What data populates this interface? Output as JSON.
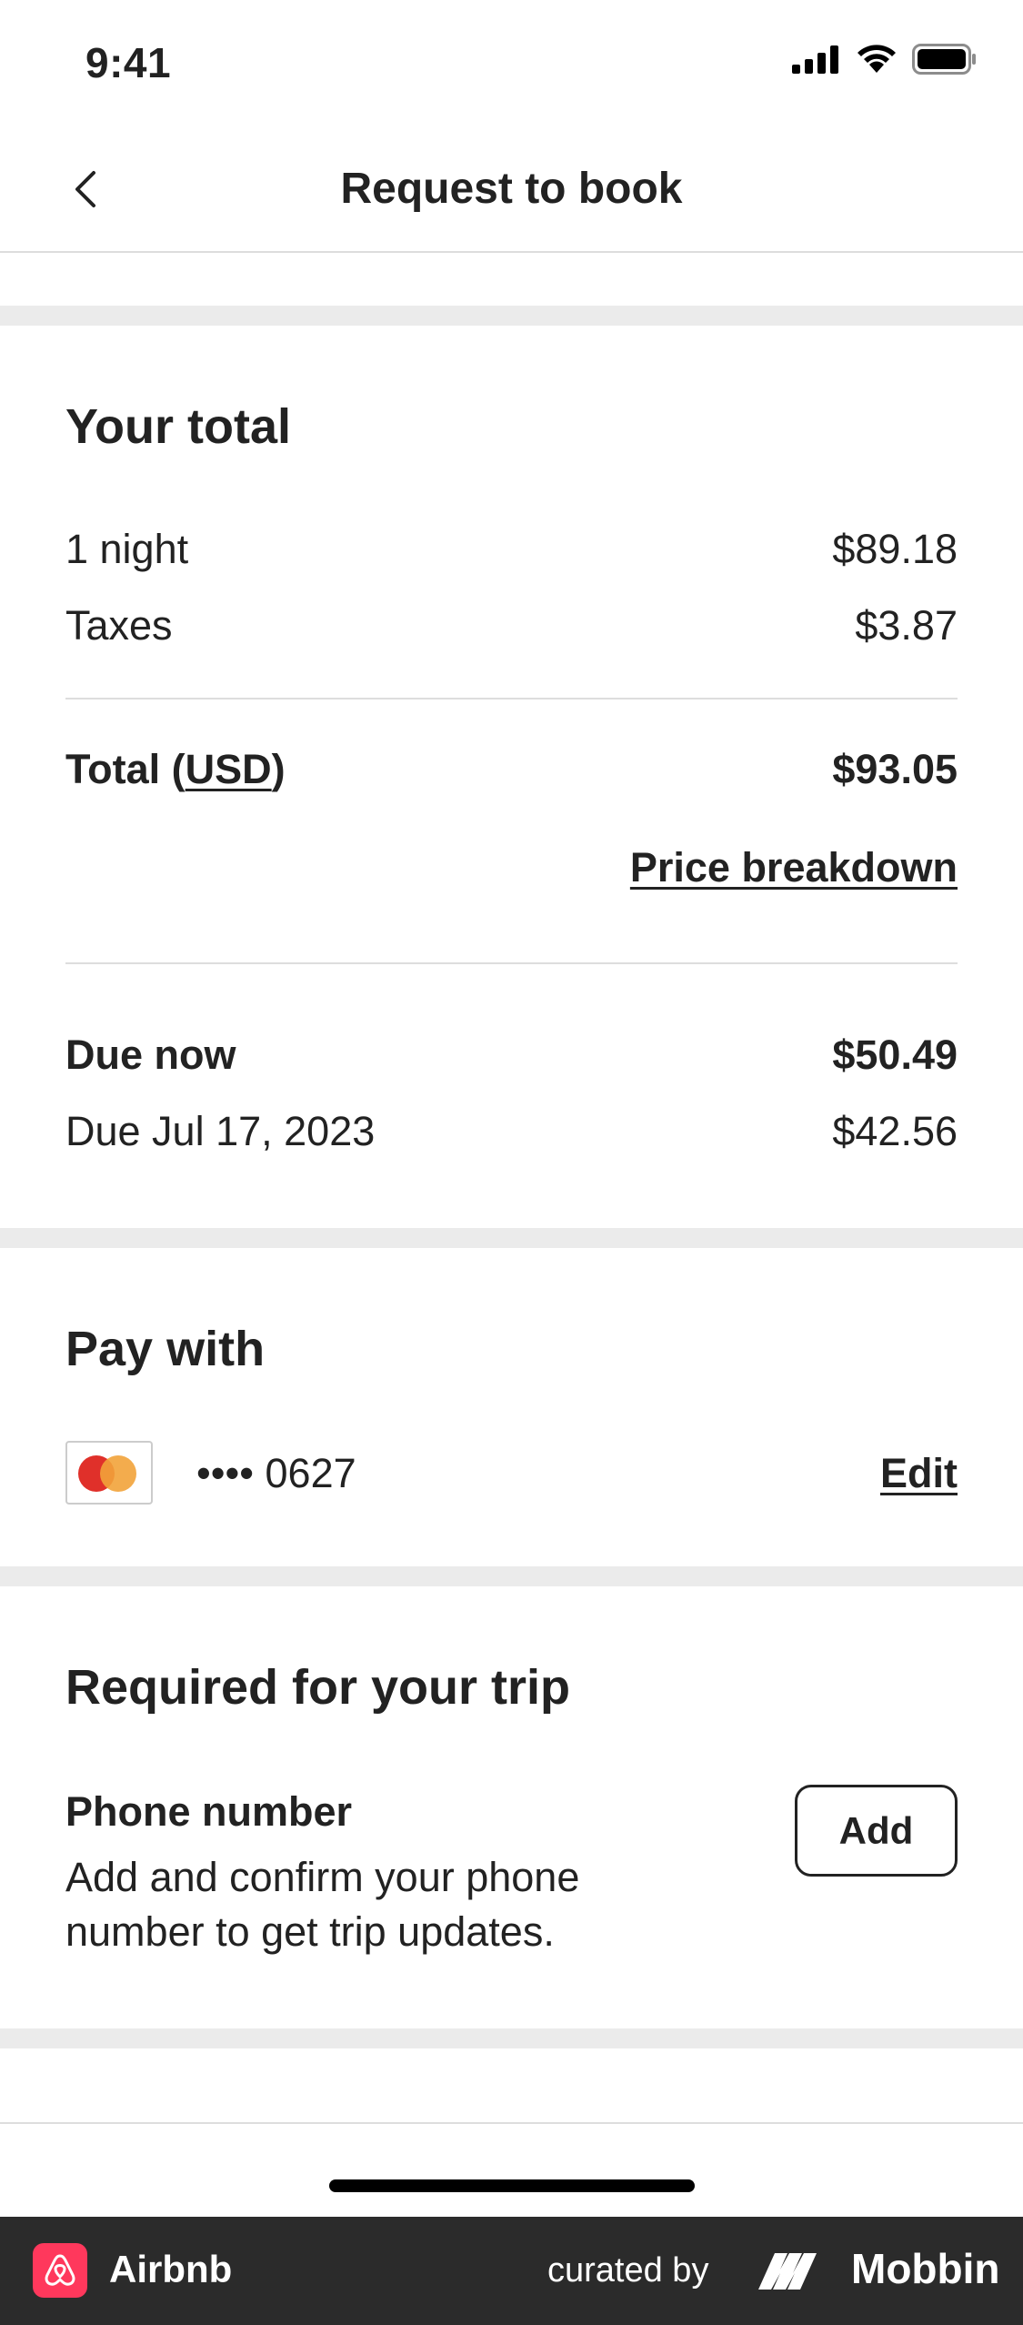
{
  "status_bar": {
    "time": "9:41"
  },
  "nav": {
    "title": "Request to book"
  },
  "total": {
    "heading": "Your total",
    "rows": [
      {
        "label": "1 night",
        "value": "$89.18"
      },
      {
        "label": "Taxes",
        "value": "$3.87"
      }
    ],
    "total_label_prefix": "Total (",
    "currency": "USD",
    "total_label_suffix": ")",
    "total_value": "$93.05",
    "price_breakdown_link": "Price breakdown",
    "due_now_label": "Due now",
    "due_now_value": "$50.49",
    "due_later_label": "Due Jul 17, 2023",
    "due_later_value": "$42.56"
  },
  "pay_with": {
    "heading": "Pay with",
    "card_masked": "•••• 0627",
    "edit_link": "Edit"
  },
  "required": {
    "heading": "Required for your trip",
    "phone_title": "Phone number",
    "phone_desc": "Add and confirm your phone number to get trip updates.",
    "add_button": "Add"
  },
  "footer": {
    "app_name": "Airbnb",
    "curated_by": "curated by",
    "brand": "Mobbin"
  },
  "colors": {
    "text": "#222222",
    "divider_band": "#ebebeb",
    "airbnb_brand": "#ff385c",
    "footer_bg": "#2b2b2b"
  }
}
